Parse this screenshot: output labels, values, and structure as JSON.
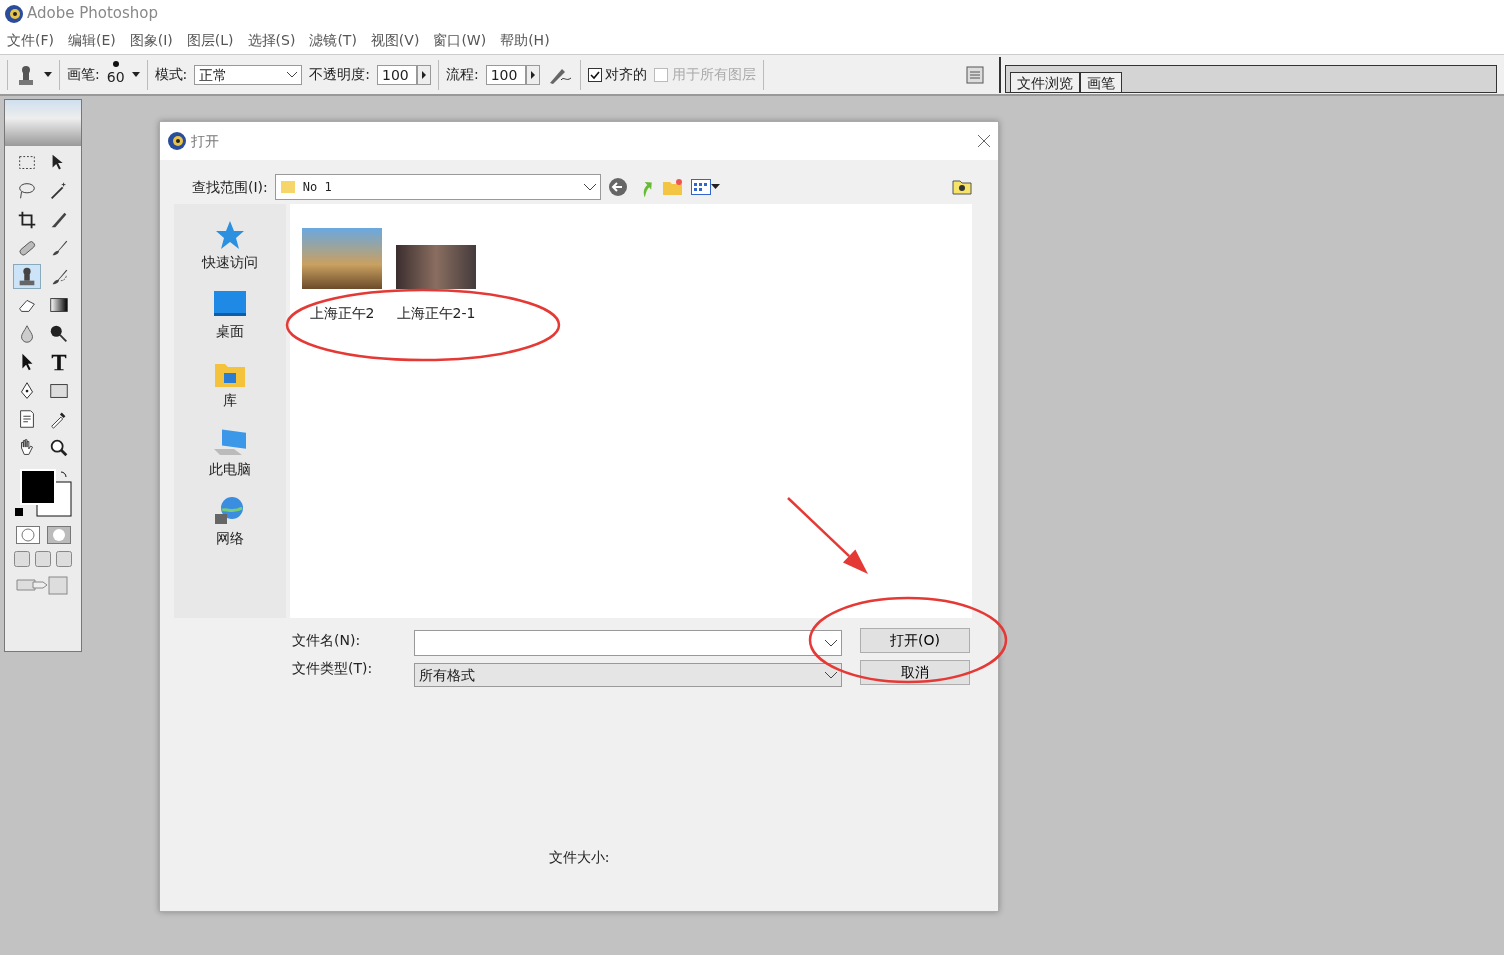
{
  "app": {
    "title": "Adobe Photoshop"
  },
  "menu": [
    "文件(F)",
    "编辑(E)",
    "图象(I)",
    "图层(L)",
    "选择(S)",
    "滤镜(T)",
    "视图(V)",
    "窗口(W)",
    "帮助(H)"
  ],
  "options_bar": {
    "brush_label": "画笔:",
    "brush_size": "60",
    "mode_label": "模式:",
    "mode_value": "正常",
    "opacity_label": "不透明度:",
    "opacity_value": "100",
    "flow_label": "流程:",
    "flow_value": "100",
    "checks": [
      {
        "label": "对齐的",
        "checked": true,
        "disabled": false
      },
      {
        "label": "用于所有图层",
        "checked": false,
        "disabled": true
      }
    ]
  },
  "palette_tabs": [
    "文件浏览",
    "画笔"
  ],
  "toolbox": {
    "tools": [
      {
        "kind": "marquee",
        "selected": false
      },
      {
        "kind": "move",
        "selected": false
      },
      {
        "kind": "lasso",
        "selected": false
      },
      {
        "kind": "wand",
        "selected": false
      },
      {
        "kind": "crop",
        "selected": false
      },
      {
        "kind": "slice",
        "selected": false
      },
      {
        "kind": "bandage",
        "selected": false
      },
      {
        "kind": "brush",
        "selected": false
      },
      {
        "kind": "stamp",
        "selected": true
      },
      {
        "kind": "history",
        "selected": false
      },
      {
        "kind": "eraser",
        "selected": false
      },
      {
        "kind": "gradient",
        "selected": false
      },
      {
        "kind": "drop",
        "selected": false
      },
      {
        "kind": "dodge",
        "selected": false
      },
      {
        "kind": "pointer",
        "selected": false
      },
      {
        "kind": "type",
        "selected": false
      },
      {
        "kind": "pen",
        "selected": false
      },
      {
        "kind": "rect",
        "selected": false
      },
      {
        "kind": "note",
        "selected": false
      },
      {
        "kind": "eyedropper",
        "selected": false
      },
      {
        "kind": "hand",
        "selected": false
      },
      {
        "kind": "zoom",
        "selected": false
      }
    ]
  },
  "dialog": {
    "title": "打开",
    "look_in_label": "查找范围(I):",
    "look_in_value": "No 1",
    "places": [
      {
        "kind": "star",
        "label": "快速访问"
      },
      {
        "kind": "desktop",
        "label": "桌面"
      },
      {
        "kind": "library",
        "label": "库"
      },
      {
        "kind": "computer",
        "label": "此电脑"
      },
      {
        "kind": "network",
        "label": "网络"
      }
    ],
    "files": [
      {
        "name": "上海正午2",
        "kind": "tall"
      },
      {
        "name": "上海正午2-1",
        "kind": "wide"
      }
    ],
    "file_name_label": "文件名(N):",
    "file_type_label": "文件类型(T):",
    "file_type_value": "所有格式",
    "buttons": [
      "打开(O)",
      "取消"
    ],
    "file_size_label": "文件大小:"
  },
  "annotations": [
    {
      "kind": "ellipse",
      "color": "#e53935"
    },
    {
      "kind": "arrow",
      "color": "#e53935"
    },
    {
      "kind": "ellipse",
      "color": "#e53935"
    }
  ]
}
